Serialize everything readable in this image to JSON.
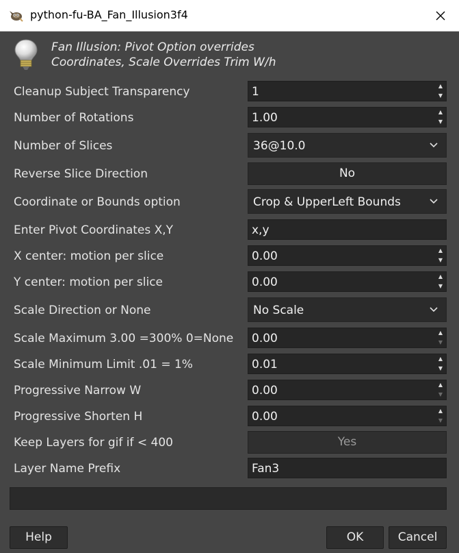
{
  "window": {
    "title": "python-fu-BA_Fan_Illusion3f4"
  },
  "header": {
    "line1": "Fan Illusion:  Pivot Option overrides",
    "line2": "Coordinates, Scale Overrides Trim W/h"
  },
  "fields": {
    "cleanup": {
      "label": "Cleanup Subject Transparency",
      "value": "1"
    },
    "rotations": {
      "label": "Number of Rotations",
      "value": "1.00"
    },
    "slices": {
      "label": "Number of Slices",
      "value": "36@10.0"
    },
    "reverse": {
      "label": "Reverse Slice Direction",
      "value": "No"
    },
    "coord_option": {
      "label": "Coordinate or Bounds option",
      "value": "Crop & UpperLeft Bounds"
    },
    "pivot": {
      "label": "Enter Pivot Coordinates X,Y",
      "value": "x,y"
    },
    "xcenter": {
      "label": "X center: motion per slice",
      "value": "0.00"
    },
    "ycenter": {
      "label": "Y center: motion per slice",
      "value": "0.00"
    },
    "scale_dir": {
      "label": "Scale Direction or None",
      "value": "No Scale"
    },
    "scale_max": {
      "label": "Scale Maximum 3.00 =300% 0=None",
      "value": "0.00"
    },
    "scale_min": {
      "label": "Scale Minimum Limit .01 = 1%",
      "value": "0.01"
    },
    "narrow_w": {
      "label": "Progressive Narrow W",
      "value": "0.00"
    },
    "shorten_h": {
      "label": "Progressive Shorten H",
      "value": "0.00"
    },
    "keep_layers": {
      "label": "Keep Layers for gif if < 400",
      "value": "Yes"
    },
    "prefix": {
      "label": "Layer Name Prefix",
      "value": "Fan3"
    }
  },
  "buttons": {
    "help": "Help",
    "ok": "OK",
    "cancel": "Cancel"
  },
  "icons": {
    "app": "gimp-icon",
    "header": "lightbulb-icon",
    "close": "close-icon",
    "dropdown": "chevron-down-icon"
  }
}
